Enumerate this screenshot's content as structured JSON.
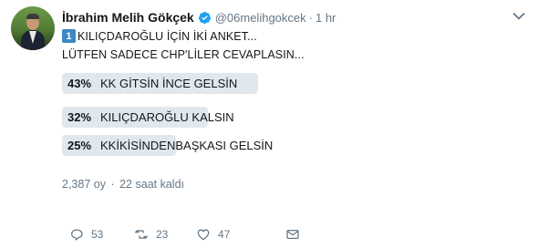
{
  "author": {
    "name": "İbrahim Melih Gökçek",
    "handle": "@06melihgokcek",
    "time": "1 hr"
  },
  "tweet": {
    "keycap": "1",
    "line1": "KILIÇDAROĞLU İÇİN İKİ ANKET...",
    "line2": "LÜTFEN SADECE CHP'LİLER CEVAPLASIN..."
  },
  "poll": {
    "options": [
      {
        "percent_label": "43%",
        "percent": 43,
        "label": "KK GİTSİN İNCE GELSİN"
      },
      {
        "percent_label": "32%",
        "percent": 32,
        "label": "KILIÇDAROĞLU KALSIN"
      },
      {
        "percent_label": "25%",
        "percent": 25,
        "label": "KKİKİSİNDENBAŞKASI GELSİN"
      }
    ],
    "votes": "2,387 oy",
    "separator": "·",
    "remaining": "22 saat kaldı"
  },
  "actions": {
    "reply_count": "53",
    "retweet_count": "23",
    "like_count": "47"
  },
  "colors": {
    "verified": "#1da1f2",
    "poll_bar": "#e1e8ed",
    "muted_text": "#657786",
    "keycap": "#3b88c3"
  }
}
